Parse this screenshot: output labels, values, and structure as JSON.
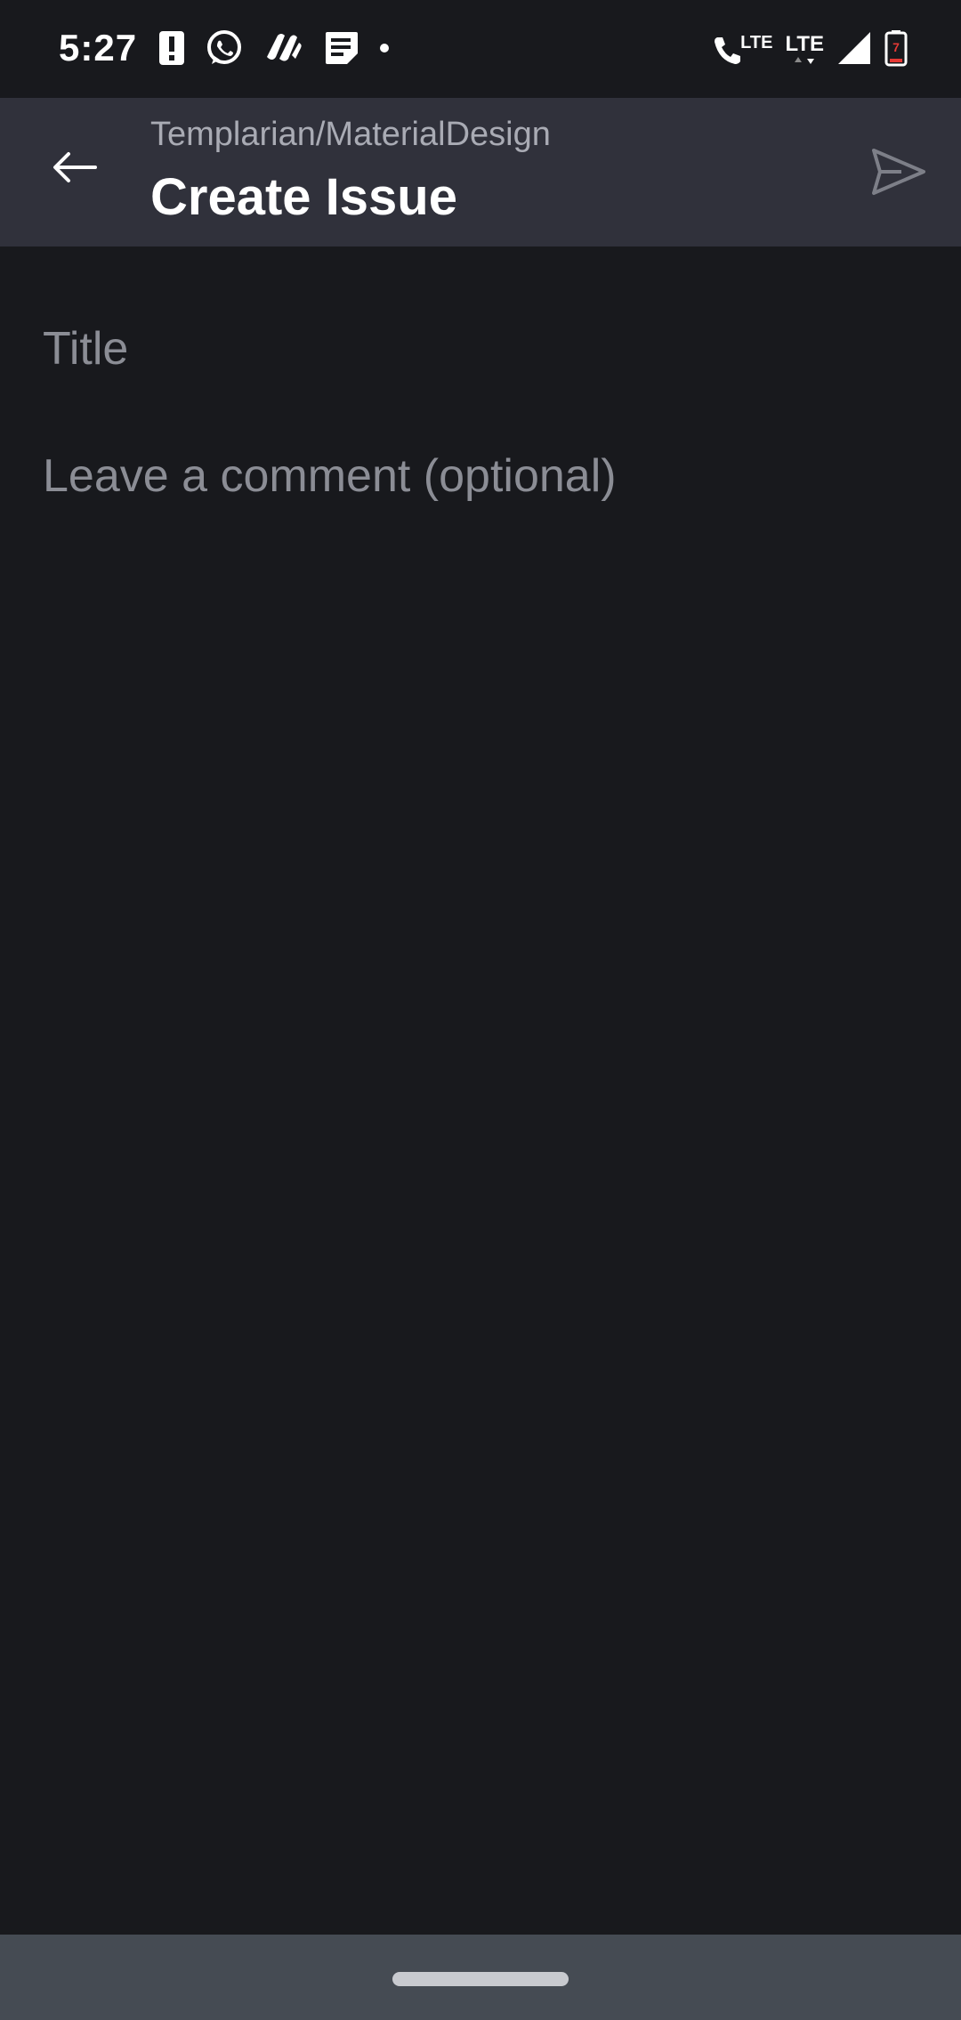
{
  "status_bar": {
    "time": "5:27",
    "lte_call": "LTE",
    "lte_data": "LTE",
    "battery_level": "7",
    "icons": [
      "alert-icon",
      "whatsapp-icon",
      "app-icon",
      "notes-icon",
      "notification-dot-icon",
      "lte-call-icon",
      "lte-data-icon",
      "signal-icon",
      "battery-icon"
    ]
  },
  "app_bar": {
    "subtitle": "Templarian/MaterialDesign",
    "title": "Create Issue",
    "back_icon": "arrow-left-icon",
    "send_icon": "send-icon"
  },
  "form": {
    "title_placeholder": "Title",
    "title_value": "",
    "comment_placeholder": "Leave a comment (optional)",
    "comment_value": ""
  },
  "colors": {
    "background": "#18191d",
    "app_bar": "#30313b",
    "nav_bar": "#454b53",
    "placeholder": "#8b8d95",
    "subtitle": "#a9abb4",
    "title": "#ffffff"
  }
}
